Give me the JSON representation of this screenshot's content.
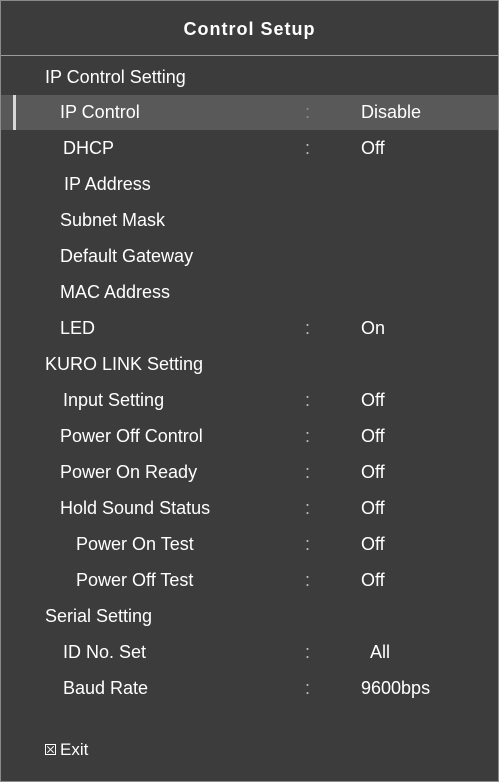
{
  "title": "Control Setup",
  "sections": {
    "ip": "IP Control Setting",
    "kuro": "KURO LINK Setting",
    "serial": "Serial Setting"
  },
  "items": {
    "ip_control": {
      "label": "IP Control",
      "sep": ":",
      "value": "Disable"
    },
    "dhcp": {
      "label": "DHCP",
      "sep": ":",
      "value": "Off"
    },
    "ip_address": {
      "label": "IP Address"
    },
    "subnet_mask": {
      "label": "Subnet Mask"
    },
    "default_gateway": {
      "label": "Default Gateway"
    },
    "mac_address": {
      "label": "MAC Address"
    },
    "led": {
      "label": "LED",
      "sep": ":",
      "value": "On"
    },
    "input_setting": {
      "label": "Input Setting",
      "sep": ":",
      "value": "Off"
    },
    "power_off_control": {
      "label": "Power Off Control",
      "sep": ":",
      "value": "Off"
    },
    "power_on_ready": {
      "label": "Power On Ready",
      "sep": ":",
      "value": "Off"
    },
    "hold_sound_status": {
      "label": "Hold Sound Status",
      "sep": ":",
      "value": "Off"
    },
    "power_on_test": {
      "label": "Power On Test",
      "sep": ":",
      "value": "Off"
    },
    "power_off_test": {
      "label": "Power Off Test",
      "sep": ":",
      "value": "Off"
    },
    "id_no_set": {
      "label": "ID No. Set",
      "sep": ":",
      "value": "All"
    },
    "baud_rate": {
      "label": "Baud Rate",
      "sep": ":",
      "value": "9600bps"
    }
  },
  "exit": {
    "label": "Exit",
    "icon": "close-box-icon"
  },
  "colors": {
    "panel": "#3c3c3c",
    "selected_row": "#595959",
    "text": "#ffffff"
  }
}
